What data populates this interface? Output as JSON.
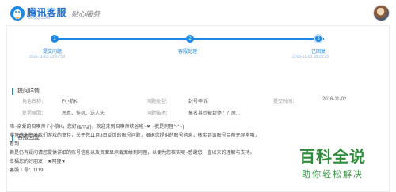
{
  "header": {
    "brand": "腾讯客服",
    "brand_url": "KF.QQ.COM",
    "slogan": "贴心服务"
  },
  "progress": {
    "steps": [
      {
        "number": "1",
        "label": "提交问题",
        "time": "2016-11-03 13:07:59"
      },
      {
        "number": "2",
        "label": "客服处理",
        "time": ""
      },
      {
        "number": "3",
        "label": "已回复",
        "time": "2016-11-03 18:25:25"
      }
    ],
    "current_step": 3
  },
  "details": {
    "title": "提问详情",
    "fields": [
      {
        "label": "角色名称：",
        "value": "F小航K"
      },
      {
        "label": "问题类型：",
        "value": "封号申诉"
      },
      {
        "label": "提交时间：",
        "value": "2016-11-02"
      },
      {
        "label": "处罚原因：",
        "value": "恶意、挂机、送人头"
      },
      {
        "label": "问题描述：",
        "value": "莫名其妙被封停？？原..."
      }
    ]
  },
  "reply": {
    "title": "客服回复",
    "lines": [
      "嗨~亲爱的召唤师 F小航K，您好(≧▽≦)，欢迎来到召唤师峡谷啦~❤ ~我是阿狸^-^~)",
      "非常感谢您对我们游戏的支持，关于您11月3日反馈的账号问题，根据您提供的账号信息，核实到该账号目前无异常哦，",
      "看到",
      "若是仍有疑问请您提供详细的账号信息以及页面显示截图给到阿狸，以便为您核实呢~感谢您一直以来的理解与支持。",
      "幸福您的好朋友：★阿狸★",
      "客服工号：1119"
    ]
  },
  "watermark": {
    "main": "百科全说",
    "sub": "助你轻松解决"
  },
  "colors": {
    "accent": "#1e88e5",
    "brand": "#1a6fd0",
    "watermark": "#2e8b3a"
  }
}
